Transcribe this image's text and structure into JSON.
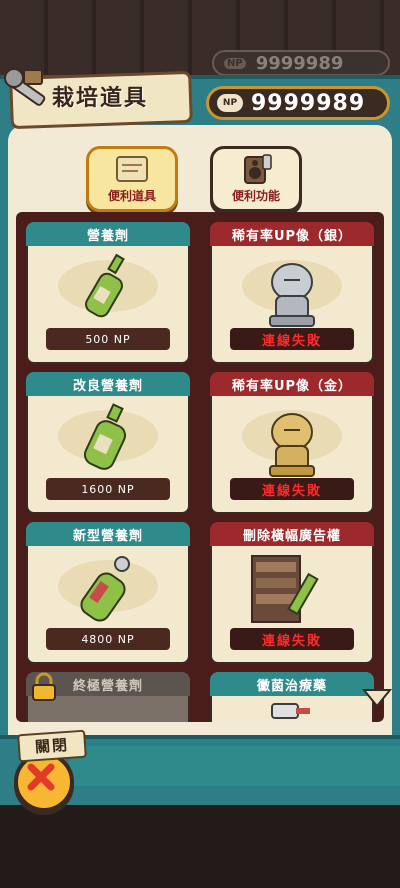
{
  "header": {
    "title": "栽培道具",
    "np_badge": "NP",
    "np_value": "9999989",
    "ghost_np_value": "9999989"
  },
  "categories": [
    {
      "label": "便利道具",
      "icon": "scroll-icon",
      "selected": true
    },
    {
      "label": "便利功能",
      "icon": "speaker-icon",
      "selected": false
    }
  ],
  "items": [
    {
      "name": "營養劑",
      "price": "500 NP",
      "status": "",
      "header_color": "#2f8a8c",
      "icon": "bottle-icon"
    },
    {
      "name": "稀有率UP像（銀）",
      "price": "",
      "status": "連線失敗",
      "header_color": "#9c2a2c",
      "icon": "silver-statue-icon"
    },
    {
      "name": "改良營養劑",
      "price": "1600 NP",
      "status": "",
      "header_color": "#2f8a8c",
      "icon": "bottle-icon"
    },
    {
      "name": "稀有率UP像（金）",
      "price": "",
      "status": "連線失敗",
      "header_color": "#9c2a2c",
      "icon": "gold-statue-icon"
    },
    {
      "name": "新型營養劑",
      "price": "4800 NP",
      "status": "",
      "header_color": "#2f8a8c",
      "icon": "bottle-icon"
    },
    {
      "name": "刪除橫幅廣告權",
      "price": "",
      "status": "連線失敗",
      "header_color": "#9c2a2c",
      "icon": "ad-remove-icon"
    },
    {
      "name": "終極營養劑",
      "price": "",
      "status": "",
      "header_color": "#5c544e",
      "icon": "lock-icon",
      "locked": true
    },
    {
      "name": "黴菌治療藥",
      "price": "",
      "status": "",
      "header_color": "#2f8a8c",
      "icon": "spray-icon"
    }
  ],
  "footer": {
    "close_label": "關閉"
  }
}
